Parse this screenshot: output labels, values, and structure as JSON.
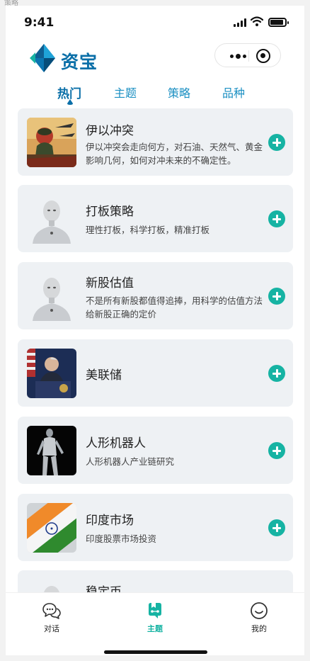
{
  "page_label": "策略",
  "status_bar": {
    "time": "9:41"
  },
  "header": {
    "app_title": "资宝"
  },
  "tabs": [
    {
      "label": "热门",
      "active": true
    },
    {
      "label": "主题",
      "active": false
    },
    {
      "label": "策略",
      "active": false
    },
    {
      "label": "品种",
      "active": false
    }
  ],
  "topics": [
    {
      "title": "伊以冲突",
      "desc": "伊以冲突会走向何方，对石油、天然气、黄金影响几何，如何对冲未来的不确定性。",
      "image": "conflict-illustration"
    },
    {
      "title": "打板策略",
      "desc": "理性打板，科学打板，精准打板",
      "image": "robot-avatar"
    },
    {
      "title": "新股估值",
      "desc": "不是所有新股都值得追捧，用科学的估值方法给新股正确的定价",
      "image": "robot-avatar"
    },
    {
      "title": "美联储",
      "desc": "",
      "image": "fed-speaker-photo"
    },
    {
      "title": "人形机器人",
      "desc": "人形机器人产业链研究",
      "image": "humanoid-robot-photo"
    },
    {
      "title": "印度市场",
      "desc": "印度股票市场投资",
      "image": "india-flag"
    },
    {
      "title": "稳定币",
      "desc": "",
      "image": "robot-avatar"
    }
  ],
  "tabbar": [
    {
      "label": "对话",
      "icon": "chat-icon",
      "active": false
    },
    {
      "label": "主题",
      "icon": "topic-icon",
      "active": true
    },
    {
      "label": "我的",
      "icon": "profile-icon",
      "active": false
    }
  ],
  "colors": {
    "brand": "#0a6fa8",
    "accent": "#16b3a3",
    "card_bg": "#eef1f4"
  }
}
